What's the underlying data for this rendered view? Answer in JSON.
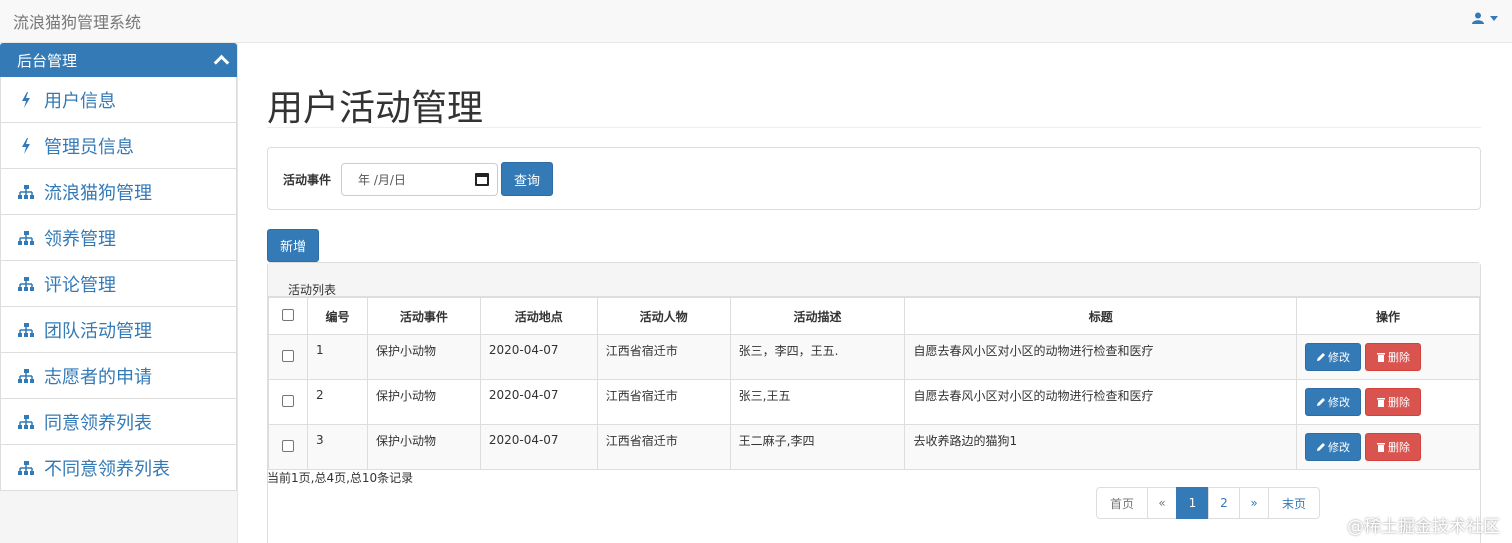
{
  "app": {
    "title": "流浪猫狗管理系统"
  },
  "user_menu": {
    "icon": "user-icon"
  },
  "sidebar": {
    "header": "后台管理",
    "items": [
      {
        "label": "用户信息",
        "icon": "bolt-icon"
      },
      {
        "label": "管理员信息",
        "icon": "bolt-icon"
      },
      {
        "label": "流浪猫狗管理",
        "icon": "sitemap-icon"
      },
      {
        "label": "领养管理",
        "icon": "sitemap-icon"
      },
      {
        "label": "评论管理",
        "icon": "sitemap-icon"
      },
      {
        "label": "团队活动管理",
        "icon": "sitemap-icon"
      },
      {
        "label": "志愿者的申请",
        "icon": "sitemap-icon"
      },
      {
        "label": "同意领养列表",
        "icon": "sitemap-icon"
      },
      {
        "label": "不同意领养列表",
        "icon": "sitemap-icon"
      }
    ]
  },
  "main": {
    "title": "用户活动管理",
    "search": {
      "label": "活动事件",
      "date_placeholder": "年 /月/日",
      "query_label": "查询"
    },
    "add_label": "新增",
    "list_title": "活动列表",
    "table": {
      "headers": [
        "编号",
        "活动事件",
        "活动地点",
        "活动人物",
        "活动描述",
        "标题",
        "操作"
      ],
      "rows": [
        {
          "id": "1",
          "event": "保护小动物",
          "place": "2020-04-07",
          "person": "江西省宿迁市",
          "desc": "张三，李四，王五.",
          "title": "自愿去春风小区对小区的动物进行检查和医疗"
        },
        {
          "id": "2",
          "event": "保护小动物",
          "place": "2020-04-07",
          "person": "江西省宿迁市",
          "desc": "张三,王五",
          "title": "自愿去春风小区对小区的动物进行检查和医疗"
        },
        {
          "id": "3",
          "event": "保护小动物",
          "place": "2020-04-07",
          "person": "江西省宿迁市",
          "desc": "王二麻子,李四",
          "title": "去收养路边的猫狗1"
        }
      ],
      "edit_label": "修改",
      "delete_label": "删除"
    },
    "page_info": "当前1页,总4页,总10条记录",
    "pagination": [
      "首页",
      "«",
      "1",
      "2",
      "»",
      "末页"
    ]
  },
  "watermark": "@稀土掘金技术社区",
  "colors": {
    "primary": "#337ab7",
    "danger": "#d9534f"
  }
}
